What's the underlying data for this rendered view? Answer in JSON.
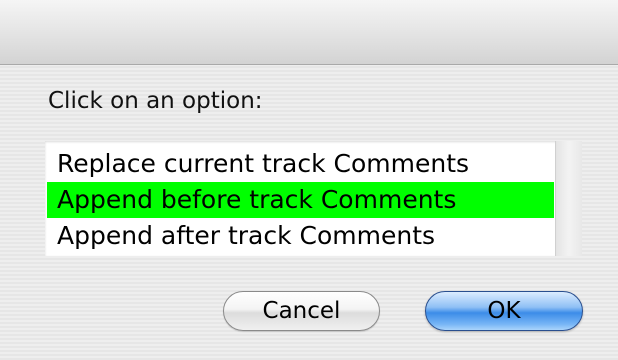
{
  "dialog": {
    "prompt": "Click on an option:"
  },
  "options": [
    {
      "label": "Replace current track Comments",
      "selected": false
    },
    {
      "label": "Append before track Comments",
      "selected": true
    },
    {
      "label": "Append after track Comments",
      "selected": false
    }
  ],
  "buttons": {
    "cancel_label": "Cancel",
    "ok_label": "OK"
  },
  "colors": {
    "selection_highlight": "#00ff00",
    "default_button": "#3c8ce8"
  }
}
